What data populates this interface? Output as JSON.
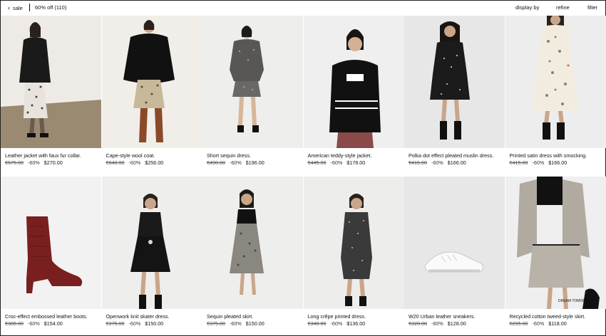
{
  "topbar": {
    "back_label": "sale",
    "count_label": "60% off (110)",
    "display_by_label": "display by",
    "refine_label": "refine",
    "filter_label": "filter"
  },
  "products": [
    {
      "name": "Leather jacket with faux fur collar.",
      "old_price": "€675.00",
      "discount": "-60%",
      "price": "$270.00",
      "image": "model-leather-jacket"
    },
    {
      "name": "Cape-style wool coat.",
      "old_price": "€640.00",
      "discount": "-60%",
      "price": "$256.00",
      "image": "model-cape-coat"
    },
    {
      "name": "Short sequin dress.",
      "old_price": "€490.00",
      "discount": "-60%",
      "price": "$196.00",
      "image": "model-sequin-dress"
    },
    {
      "name": "American teddy-style jacket.",
      "old_price": "€445.00",
      "discount": "-60%",
      "price": "$178.00",
      "image": "model-teddy-jacket"
    },
    {
      "name": "Polka dot effect pleated muslin dress.",
      "old_price": "€415.00",
      "discount": "-60%",
      "price": "$166.00",
      "image": "model-polka-dress"
    },
    {
      "name": "Printed satin dress with smocking.",
      "old_price": "€415.00",
      "discount": "-60%",
      "price": "$166.00",
      "image": "model-satin-dress"
    },
    {
      "name": "Croc-effect embossed leather boots.",
      "old_price": "€385.00",
      "discount": "-60%",
      "price": "$154.00",
      "image": "croc-boot"
    },
    {
      "name": "Openwork knit skater dress.",
      "old_price": "€375.00",
      "discount": "-60%",
      "price": "$150.00",
      "image": "model-skater-dress"
    },
    {
      "name": "Sequin pleated skirt.",
      "old_price": "€375.00",
      "discount": "-60%",
      "price": "$150.00",
      "image": "model-pleated-skirt"
    },
    {
      "name": "Long crêpe printed dress.",
      "old_price": "€340.00",
      "discount": "-60%",
      "price": "$136.00",
      "image": "model-crepe-dress"
    },
    {
      "name": "W20 Urban leather sneakers.",
      "old_price": "€320.00",
      "discount": "-60%",
      "price": "$128.00",
      "image": "white-sneakers"
    },
    {
      "name": "Recycled cotton tweed-style skirt.",
      "old_price": "€295.00",
      "discount": "-60%",
      "price": "$118.00",
      "image": "model-tweed-skirt",
      "image_caption": "DREAM TOMORROW"
    }
  ]
}
